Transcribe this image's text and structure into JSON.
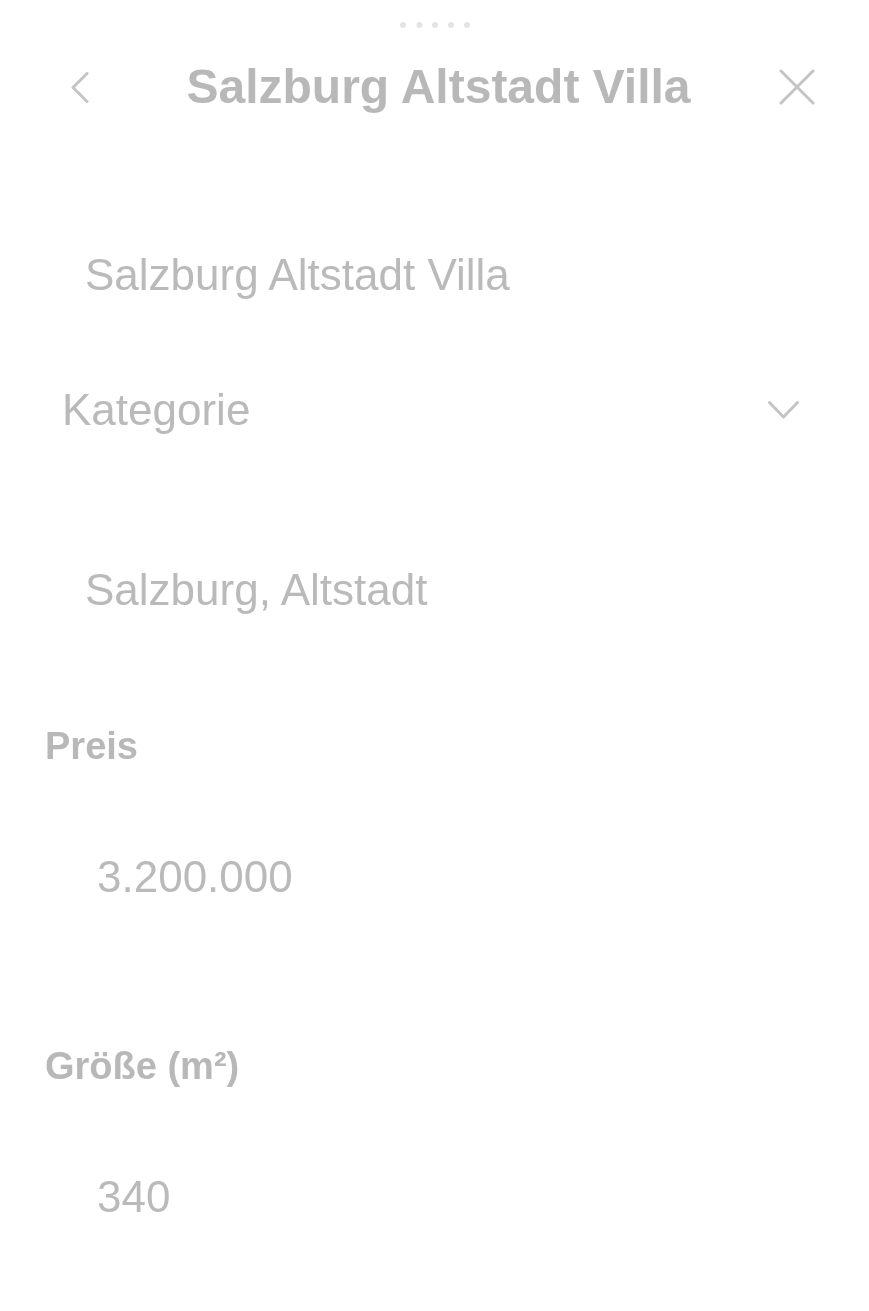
{
  "header": {
    "title": "Salzburg Altstadt Villa"
  },
  "fields": [
    {
      "kind": "text",
      "value": "Salzburg Altstadt Villa"
    },
    {
      "kind": "select",
      "placeholder": "Kategorie"
    },
    {
      "kind": "text",
      "value": "Salzburg, Altstadt"
    },
    {
      "kind": "labeled",
      "label": "Preis",
      "value": "3.200.000"
    },
    {
      "kind": "labeled",
      "label": "Größe (m²)",
      "value": "340"
    }
  ]
}
